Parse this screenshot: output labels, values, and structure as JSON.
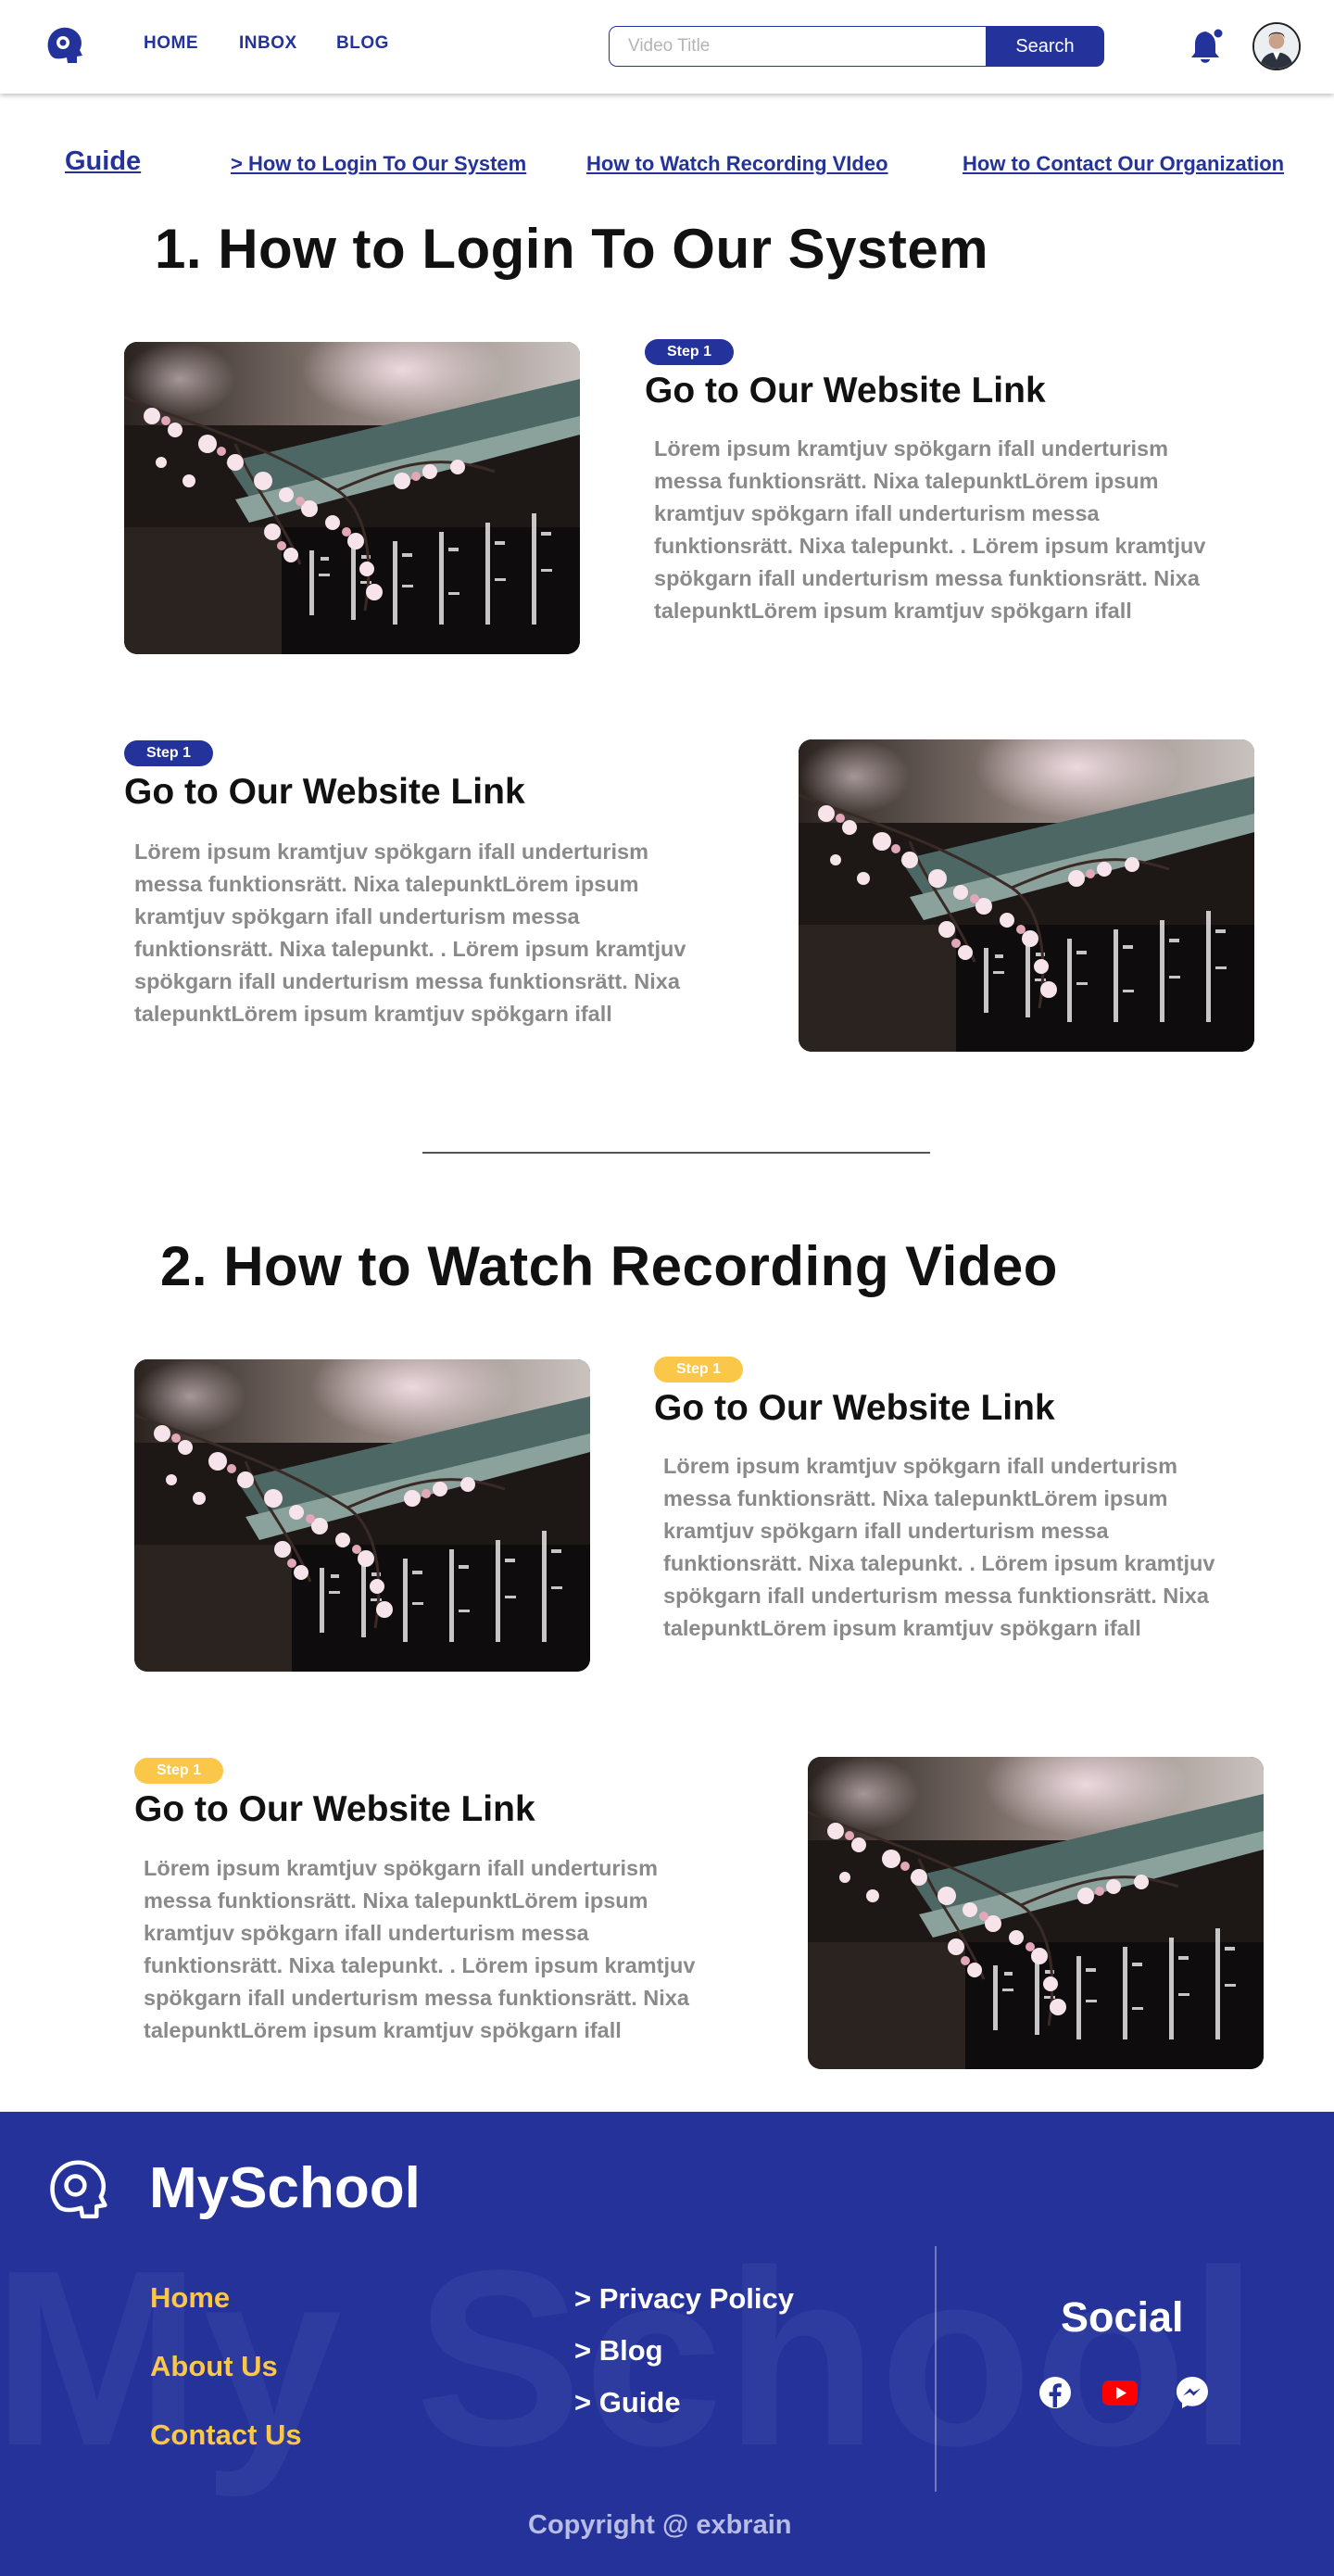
{
  "header": {
    "nav": [
      "HOME",
      "INBOX",
      "BLOG"
    ],
    "search": {
      "placeholder": "Video Title",
      "button": "Search"
    }
  },
  "guide": {
    "title": "Guide",
    "links": [
      "> How to Login To Our System",
      "How to Watch Recording VIdeo",
      "How to Contact Our Organization"
    ]
  },
  "sections": [
    {
      "title": "1. How to Login To Our System",
      "steps": [
        {
          "badge": "Step 1",
          "title": "Go to Our Website Link",
          "body": "Lörem ipsum kramtjuv spökgarn ifall underturism messa funktionsrätt. Nixa talepunktLörem ipsum kramtjuv spökgarn ifall underturism messa funktionsrätt. Nixa talepunkt. . Lörem ipsum kramtjuv spökgarn ifall underturism messa funktionsrätt. Nixa talepunktLörem ipsum kramtjuv spökgarn ifall"
        },
        {
          "badge": "Step 1",
          "title": "Go to Our Website Link",
          "body": "Lörem ipsum kramtjuv spökgarn ifall underturism messa funktionsrätt. Nixa talepunktLörem ipsum kramtjuv spökgarn ifall underturism messa funktionsrätt. Nixa talepunkt. . Lörem ipsum kramtjuv spökgarn ifall underturism messa funktionsrätt. Nixa talepunktLörem ipsum kramtjuv spökgarn ifall"
        }
      ]
    },
    {
      "title": "2. How to Watch Recording Video",
      "steps": [
        {
          "badge": "Step 1",
          "title": "Go to Our Website Link",
          "body": "Lörem ipsum kramtjuv spökgarn ifall underturism messa funktionsrätt. Nixa talepunktLörem ipsum kramtjuv spökgarn ifall underturism messa funktionsrätt. Nixa talepunkt. . Lörem ipsum kramtjuv spökgarn ifall underturism messa funktionsrätt. Nixa talepunktLörem ipsum kramtjuv spökgarn ifall"
        },
        {
          "badge": "Step 1",
          "title": "Go to Our Website Link",
          "body": "Lörem ipsum kramtjuv spökgarn ifall underturism messa funktionsrätt. Nixa talepunktLörem ipsum kramtjuv spökgarn ifall underturism messa funktionsrätt. Nixa talepunkt. . Lörem ipsum kramtjuv spökgarn ifall underturism messa funktionsrätt. Nixa talepunktLörem ipsum kramtjuv spökgarn ifall"
        }
      ]
    }
  ],
  "footer": {
    "brand": "MySchool",
    "watermark": "My School",
    "links_left": [
      "Home",
      "About Us",
      "Contact Us"
    ],
    "links_right": [
      "> Privacy Policy",
      "> Blog",
      "> Guide"
    ],
    "social_title": "Social",
    "social_icons": [
      "facebook-icon",
      "youtube-icon",
      "messenger-icon"
    ],
    "copyright": "Copyright @ exbrain"
  },
  "colors": {
    "primary": "#23339b",
    "footer_bg": "#24329a",
    "accent_yellow": "#fbc748",
    "body_text": "#8a8a8a",
    "youtube_red": "#ff0000"
  }
}
